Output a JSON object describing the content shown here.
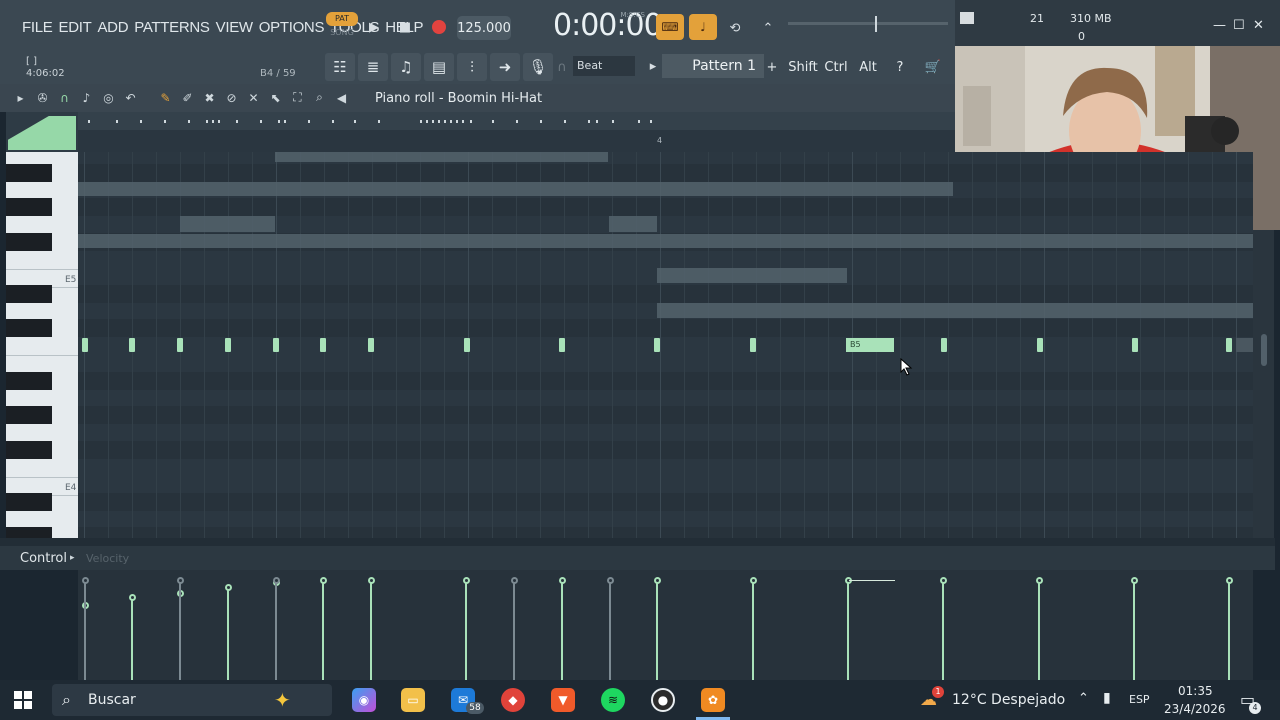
{
  "menu": [
    "FILE",
    "EDIT",
    "ADD",
    "PATTERNS",
    "VIEW",
    "OPTIONS",
    "TOOLS",
    "HELP"
  ],
  "transport": {
    "pat_label": "PAT",
    "song_label": "SONG",
    "tempo": "125.000",
    "time": "0:00:00",
    "time_format": "M:S:CS"
  },
  "hint": {
    "line1": "[  ]",
    "line2": "4:06:02",
    "position": "B4 / 59"
  },
  "snap": "Beat",
  "pattern": "Pattern 1",
  "pattern_add": "+",
  "modifiers": [
    "Shift",
    "Ctrl",
    "Alt"
  ],
  "monitor": {
    "cpu_value": "21",
    "memory": "310 MB",
    "polyphony": "0"
  },
  "piano_roll": {
    "title": "Piano roll - Boomin Hi-Hat",
    "ruler_label": "4",
    "key_labels": [
      "E5",
      "E4"
    ],
    "selected_note_label": "B5"
  },
  "control": {
    "label": "Control",
    "target": "Velocity"
  },
  "taskbar": {
    "search_placeholder": "Buscar",
    "mail_badge": "58",
    "weather_badge": "1",
    "weather": "12°C  Despejado",
    "language": "ESP",
    "time": "01:35",
    "date": "23/4/2026",
    "notification_badge": "4"
  }
}
